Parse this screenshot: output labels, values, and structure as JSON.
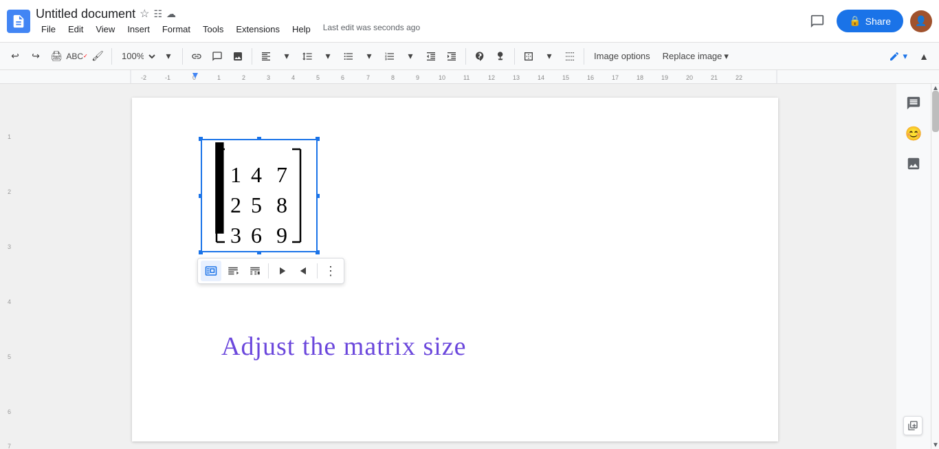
{
  "app": {
    "icon_label": "D",
    "title": "Untitled document",
    "last_edit": "Last edit was seconds ago",
    "share_label": "Share",
    "share_icon": "🔒"
  },
  "menu": {
    "items": [
      "File",
      "Edit",
      "View",
      "Insert",
      "Format",
      "Tools",
      "Extensions",
      "Help"
    ]
  },
  "toolbar": {
    "zoom": "100%",
    "image_options": "Image options",
    "replace_image": "Replace image"
  },
  "image_toolbar": {
    "buttons": [
      {
        "label": "Inline",
        "icon": "⬛"
      },
      {
        "label": "Wrap text",
        "icon": "⬛"
      },
      {
        "label": "Break text",
        "icon": "⬛"
      },
      {
        "label": "Align left",
        "icon": "⬛"
      },
      {
        "label": "Align right",
        "icon": "⬛"
      },
      {
        "label": "More",
        "icon": "⋮"
      }
    ]
  },
  "matrix": {
    "values": [
      "1",
      "4",
      "7",
      "2",
      "5",
      "8",
      "3",
      "6",
      "9"
    ]
  },
  "document_text": {
    "handwritten": "Adjust the matrix size"
  },
  "sidebar": {
    "comment_tooltip": "Add comment",
    "emoji_tooltip": "Add emoji",
    "image_tooltip": "Add image"
  },
  "colors": {
    "brand_blue": "#1a73e8",
    "handle_blue": "#1a73e8",
    "text_purple": "#6b47dc"
  }
}
